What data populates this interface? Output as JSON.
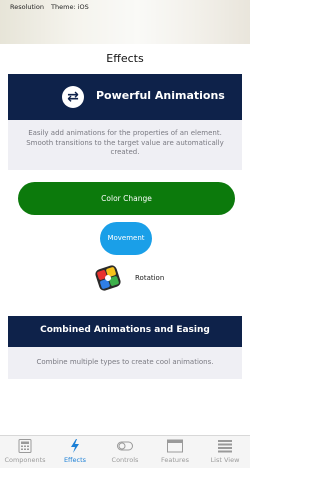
{
  "status": {
    "resolution": "Resolution",
    "theme": "Theme: iOS"
  },
  "nav": {
    "title": "Effects"
  },
  "section1": {
    "title": "Powerful Animations",
    "icon": "swap-arrows-icon",
    "description": "Easily add animations for the properties of an element. Smooth transitions to the target value are automatically created."
  },
  "demos": {
    "color_change": "Color Change",
    "movement": "Movement",
    "rotation": "Rotation"
  },
  "section2": {
    "title": "Combined Animations and Easing",
    "description": "Combine multiple types to create cool animations."
  },
  "tabs": [
    {
      "label": "Components",
      "icon": "calculator-icon",
      "active": false
    },
    {
      "label": "Effects",
      "icon": "lightning-icon",
      "active": true
    },
    {
      "label": "Controls",
      "icon": "toggle-icon",
      "active": false
    },
    {
      "label": "Features",
      "icon": "window-icon",
      "active": false
    },
    {
      "label": "List View",
      "icon": "list-icon",
      "active": false
    }
  ],
  "colors": {
    "header_bg": "#0e224a",
    "green": "#0c7a0c",
    "blue": "#1a9fe8",
    "active_tab": "#1a7fd6"
  }
}
